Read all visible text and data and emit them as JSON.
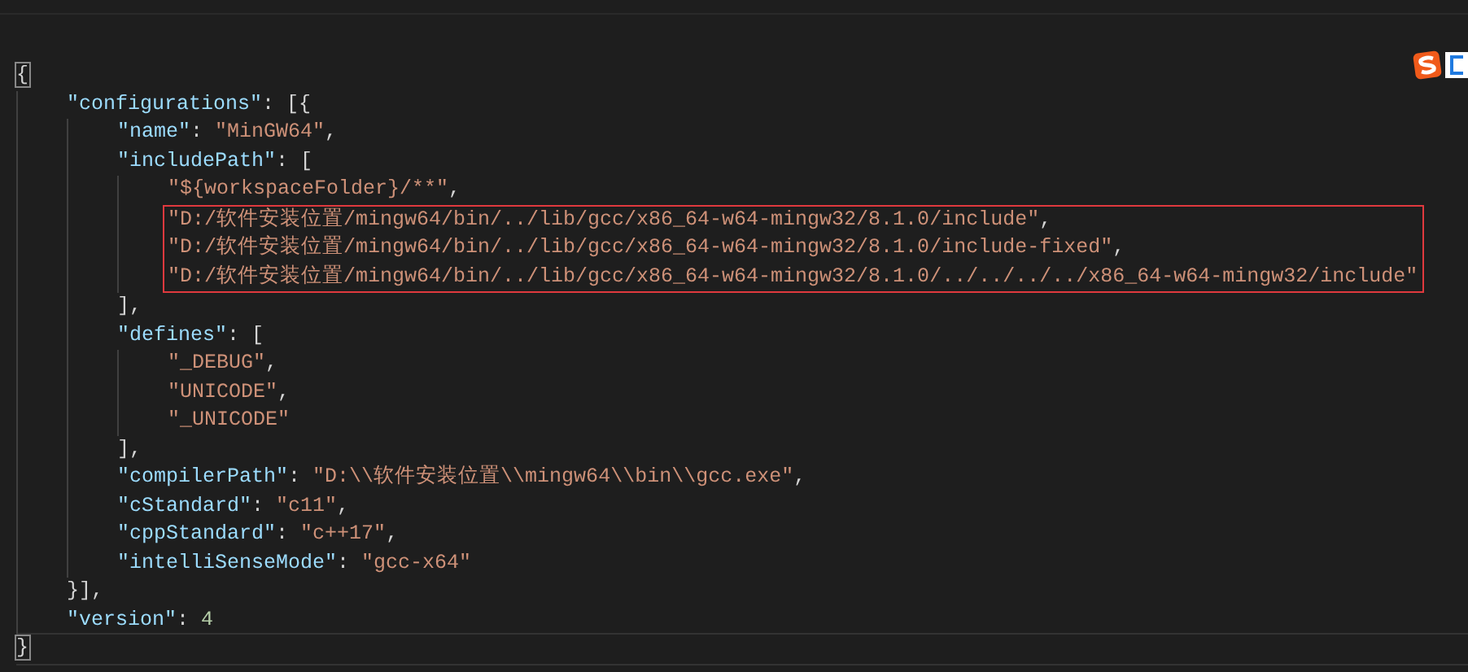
{
  "editor": {
    "lines": [
      {
        "tokens": [
          {
            "kind": "matched-bracket",
            "text": "{"
          }
        ],
        "children": [
          {
            "tokens": [
              {
                "kind": "key",
                "text": "\"configurations\""
              },
              {
                "kind": "punct",
                "text": ": [{"
              }
            ],
            "children": [
              {
                "tokens": [
                  {
                    "kind": "key",
                    "text": "\"name\""
                  },
                  {
                    "kind": "punct",
                    "text": ": "
                  },
                  {
                    "kind": "string",
                    "text": "\"MinGW64\""
                  },
                  {
                    "kind": "punct",
                    "text": ","
                  }
                ]
              },
              {
                "tokens": [
                  {
                    "kind": "key",
                    "text": "\"includePath\""
                  },
                  {
                    "kind": "punct",
                    "text": ": ["
                  }
                ],
                "children": [
                  {
                    "tokens": [
                      {
                        "kind": "string",
                        "text": "\"${workspaceFolder}/**\""
                      },
                      {
                        "kind": "punct",
                        "text": ","
                      }
                    ]
                  },
                  {
                    "highlighted": true,
                    "tokens": [
                      {
                        "kind": "string",
                        "text": "\"D:/软件安装位置/mingw64/bin/../lib/gcc/x86_64-w64-mingw32/8.1.0/include\""
                      },
                      {
                        "kind": "punct",
                        "text": ","
                      }
                    ]
                  },
                  {
                    "highlighted": true,
                    "tokens": [
                      {
                        "kind": "string",
                        "text": "\"D:/软件安装位置/mingw64/bin/../lib/gcc/x86_64-w64-mingw32/8.1.0/include-fixed\""
                      },
                      {
                        "kind": "punct",
                        "text": ","
                      }
                    ]
                  },
                  {
                    "highlighted": true,
                    "tokens": [
                      {
                        "kind": "string",
                        "text": "\"D:/软件安装位置/mingw64/bin/../lib/gcc/x86_64-w64-mingw32/8.1.0/../../../../x86_64-w64-mingw32/include\""
                      }
                    ]
                  }
                ]
              },
              {
                "tokens": [
                  {
                    "kind": "punct",
                    "text": "],"
                  }
                ]
              },
              {
                "tokens": [
                  {
                    "kind": "key",
                    "text": "\"defines\""
                  },
                  {
                    "kind": "punct",
                    "text": ": ["
                  }
                ],
                "children": [
                  {
                    "tokens": [
                      {
                        "kind": "string",
                        "text": "\"_DEBUG\""
                      },
                      {
                        "kind": "punct",
                        "text": ","
                      }
                    ]
                  },
                  {
                    "tokens": [
                      {
                        "kind": "string",
                        "text": "\"UNICODE\""
                      },
                      {
                        "kind": "punct",
                        "text": ","
                      }
                    ]
                  },
                  {
                    "tokens": [
                      {
                        "kind": "string",
                        "text": "\"_UNICODE\""
                      }
                    ]
                  }
                ]
              },
              {
                "tokens": [
                  {
                    "kind": "punct",
                    "text": "],"
                  }
                ]
              },
              {
                "tokens": [
                  {
                    "kind": "key",
                    "text": "\"compilerPath\""
                  },
                  {
                    "kind": "punct",
                    "text": ": "
                  },
                  {
                    "kind": "string",
                    "text": "\"D:\\\\软件安装位置\\\\mingw64\\\\bin\\\\gcc.exe\""
                  },
                  {
                    "kind": "punct",
                    "text": ","
                  }
                ]
              },
              {
                "tokens": [
                  {
                    "kind": "key",
                    "text": "\"cStandard\""
                  },
                  {
                    "kind": "punct",
                    "text": ": "
                  },
                  {
                    "kind": "string",
                    "text": "\"c11\""
                  },
                  {
                    "kind": "punct",
                    "text": ","
                  }
                ]
              },
              {
                "tokens": [
                  {
                    "kind": "key",
                    "text": "\"cppStandard\""
                  },
                  {
                    "kind": "punct",
                    "text": ": "
                  },
                  {
                    "kind": "string",
                    "text": "\"c++17\""
                  },
                  {
                    "kind": "punct",
                    "text": ","
                  }
                ]
              },
              {
                "tokens": [
                  {
                    "kind": "key",
                    "text": "\"intelliSenseMode\""
                  },
                  {
                    "kind": "punct",
                    "text": ": "
                  },
                  {
                    "kind": "string",
                    "text": "\"gcc-x64\""
                  }
                ]
              }
            ]
          },
          {
            "tokens": [
              {
                "kind": "punct",
                "text": "}],"
              }
            ]
          },
          {
            "tokens": [
              {
                "kind": "key",
                "text": "\"version\""
              },
              {
                "kind": "punct",
                "text": ": "
              },
              {
                "kind": "number",
                "text": "4"
              }
            ]
          }
        ]
      },
      {
        "current": true,
        "tokens": [
          {
            "kind": "matched-bracket",
            "text": "}"
          }
        ]
      }
    ]
  }
}
